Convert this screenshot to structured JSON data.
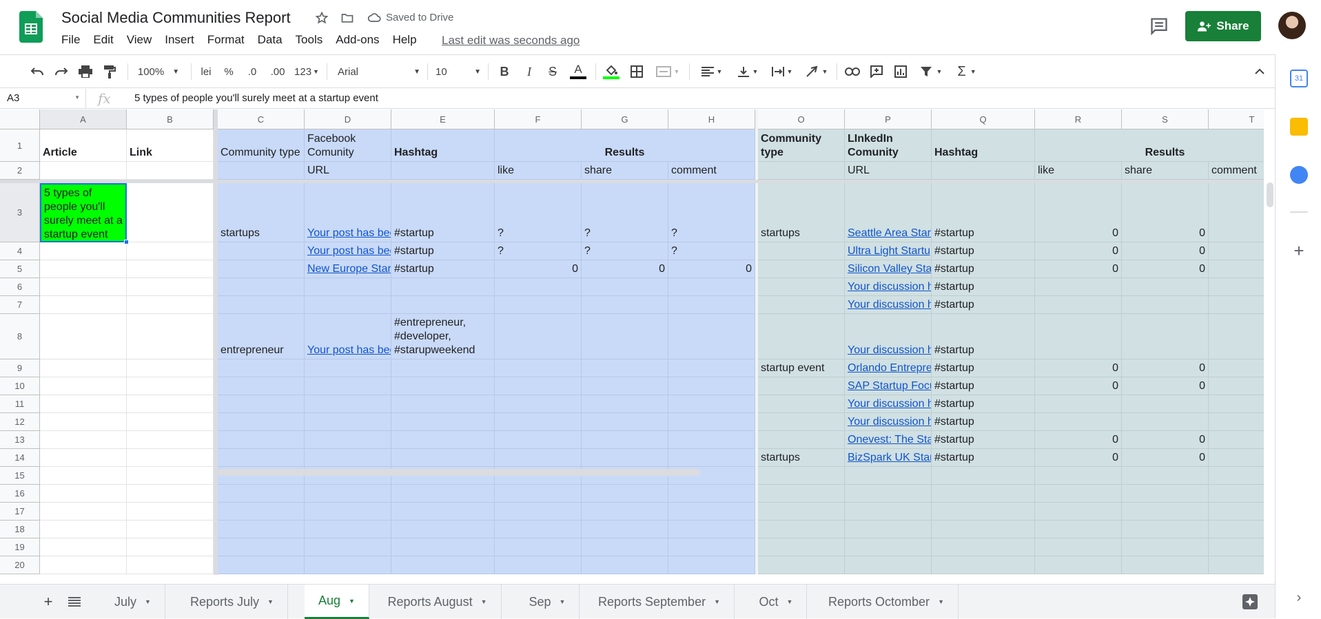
{
  "app": {
    "title": "Social Media Communities Report",
    "saved": "Saved to Drive",
    "last_edit": "Last edit was seconds ago",
    "share_label": "Share"
  },
  "menu": [
    "File",
    "Edit",
    "View",
    "Insert",
    "Format",
    "Data",
    "Tools",
    "Add-ons",
    "Help"
  ],
  "toolbar": {
    "zoom": "100%",
    "currency": "lei",
    "percent": "%",
    "dec_less": ".0",
    "dec_more": ".00",
    "format": "123",
    "font": "Arial",
    "size": "10"
  },
  "formula_bar": {
    "cell": "A3",
    "fx": "fx",
    "value": "5 types of people you'll surely meet at a startup event"
  },
  "columns": [
    "A",
    "B",
    "C",
    "D",
    "E",
    "F",
    "G",
    "H",
    "O",
    "P",
    "Q",
    "R",
    "S",
    "T"
  ],
  "rows": [
    "1",
    "2",
    "3",
    "4",
    "5",
    "6",
    "7",
    "8",
    "9",
    "10",
    "11",
    "12",
    "13",
    "14",
    "15",
    "16",
    "17",
    "18",
    "19",
    "20"
  ],
  "cells": {
    "A1": "Article",
    "B1": "Link",
    "C1": "Community type",
    "D1": "Facebook Comunity",
    "E1": "Hashtag",
    "F1": "Results",
    "O1": "Community type",
    "P1": "LInkedIn Comunity",
    "Q1": "Hashtag",
    "R1": "Results",
    "D2": "URL",
    "F2": "like",
    "G2": "share",
    "H2": "comment",
    "P2": "URL",
    "R2": "like",
    "S2": "share",
    "T2": "comment",
    "A3": "5 types of people you'll surely meet at a startup event",
    "C3": "startups",
    "D3": "Your post has been",
    "E3": "#startup",
    "F3": "?",
    "G3": "?",
    "H3": "?",
    "O3": "startups",
    "P3": "Seattle Area Startups",
    "Q3": "#startup",
    "R3": "0",
    "S3": "0",
    "D4": "Your post has been",
    "E4": "#startup",
    "F4": "?",
    "G4": "?",
    "H4": "?",
    "P4": "Ultra Light Startups",
    "Q4": "#startup",
    "R4": "0",
    "S4": "0",
    "D5": "New Europe Startups",
    "E5": "#startup",
    "F5": "0",
    "G5": "0",
    "H5": "0",
    "P5": "Silicon Valley Startups",
    "Q5": "#startup",
    "R5": "0",
    "S5": "0",
    "P6": "Your discussion has",
    "Q6": "#startup",
    "P7": "Your discussion has",
    "Q7": "#startup",
    "C8": "entrepreneur",
    "D8": "Your post has been",
    "E8": "#entrepreneur, #developer, #starupweekend",
    "P8": "Your discussion has",
    "Q8": "#startup",
    "O9": "startup event",
    "P9": "Orlando Entrepreneurs",
    "Q9": "#startup",
    "R9": "0",
    "S9": "0",
    "P10": "SAP Startup Focus",
    "Q10": "#startup",
    "R10": "0",
    "S10": "0",
    "P11": "Your discussion has",
    "Q11": "#startup",
    "P12": "Your discussion has",
    "Q12": "#startup",
    "P13": "Onevest: The Startup",
    "Q13": "#startup",
    "R13": "0",
    "S13": "0",
    "O14": "startups",
    "P14": "BizSpark UK Startups",
    "Q14": "#startup",
    "R14": "0",
    "S14": "0"
  },
  "tabs": [
    "July",
    "Reports July",
    "Aug",
    "Reports August",
    "Sep",
    "Reports September",
    "Oct",
    "Reports Octomber"
  ],
  "active_tab": "Aug",
  "colors": {
    "brand": "#188038",
    "blue_fill": "#c9daf8",
    "teal_fill": "#d0e0e3",
    "selected_fill": "#00ff00",
    "link": "#1155cc"
  }
}
